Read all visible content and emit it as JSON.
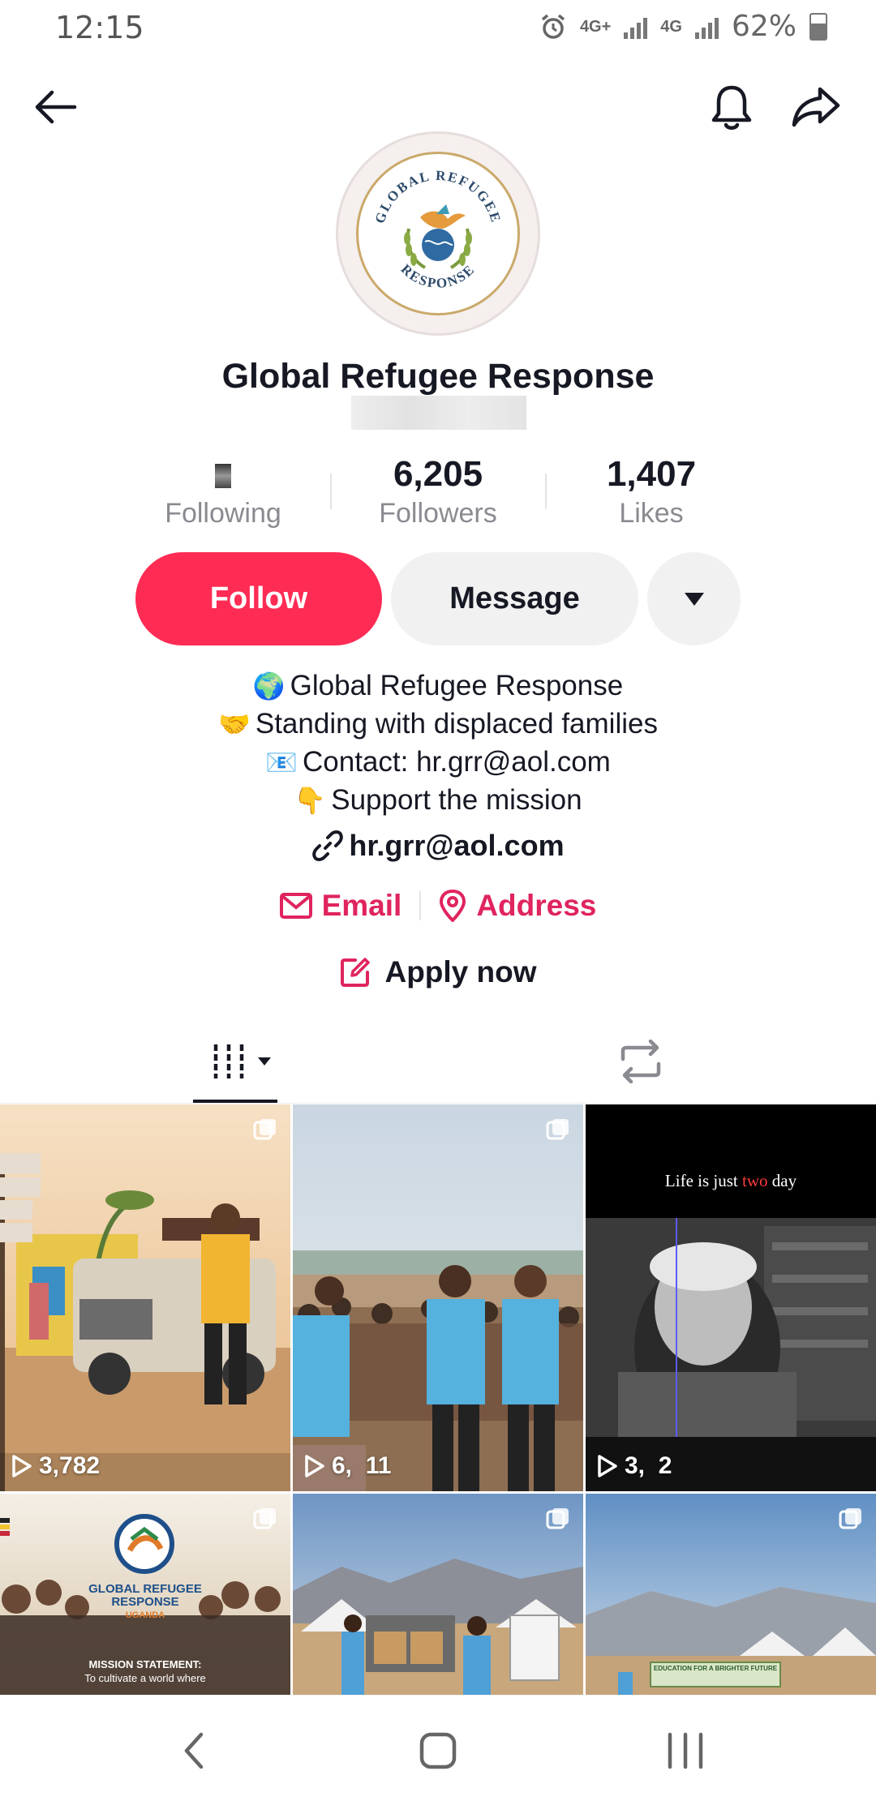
{
  "status_bar": {
    "time": "12:15",
    "network_1": "4G+",
    "network_2": "4G",
    "battery": "62%",
    "icons": [
      "alarm-icon",
      "signal-icon",
      "battery-icon"
    ]
  },
  "nav": {
    "back": "back-arrow-icon",
    "notifications": "bell-icon",
    "share": "share-icon"
  },
  "profile": {
    "avatar_text_top": "GLOBAL REFUGEE",
    "avatar_text_bottom": "RESPONSE",
    "name": "Global Refugee Response"
  },
  "stats": {
    "following_label": "Following",
    "followers_value": "6,205",
    "followers_label": "Followers",
    "likes_value": "1,407",
    "likes_label": "Likes"
  },
  "actions": {
    "follow": "Follow",
    "message": "Message"
  },
  "bio": {
    "lines": [
      {
        "emoji": "🌍",
        "text": "Global Refugee Response"
      },
      {
        "emoji": "🤝",
        "text": "Standing with displaced families"
      },
      {
        "emoji": "📧",
        "text": "Contact: hr.grr@aol.com"
      },
      {
        "emoji": "👇",
        "text": "Support the mission"
      }
    ],
    "link": "hr.grr@aol.com",
    "email_label": "Email",
    "address_label": "Address",
    "apply_label": "Apply now"
  },
  "accent_color": "#fe2c55",
  "videos": [
    {
      "views": "3,782",
      "scene": "man waving by jeep"
    },
    {
      "views": "6,  11",
      "scene": "volunteers in crowd"
    },
    {
      "views": "3,  2",
      "caption": "Life is just two day",
      "caption_highlight": "two"
    },
    {
      "caption_logo_1": "GLOBAL REFUGEE",
      "caption_logo_2": "RESPONSE",
      "caption_logo_3": "UGANDA",
      "caption_mission": "MISSION STATEMENT:",
      "caption_mission_2": "To cultivate a world where"
    },
    {
      "scene": "camp with pickup truck"
    },
    {
      "banner": "EDUCATION FOR A BRIGHTER FUTURE"
    }
  ]
}
